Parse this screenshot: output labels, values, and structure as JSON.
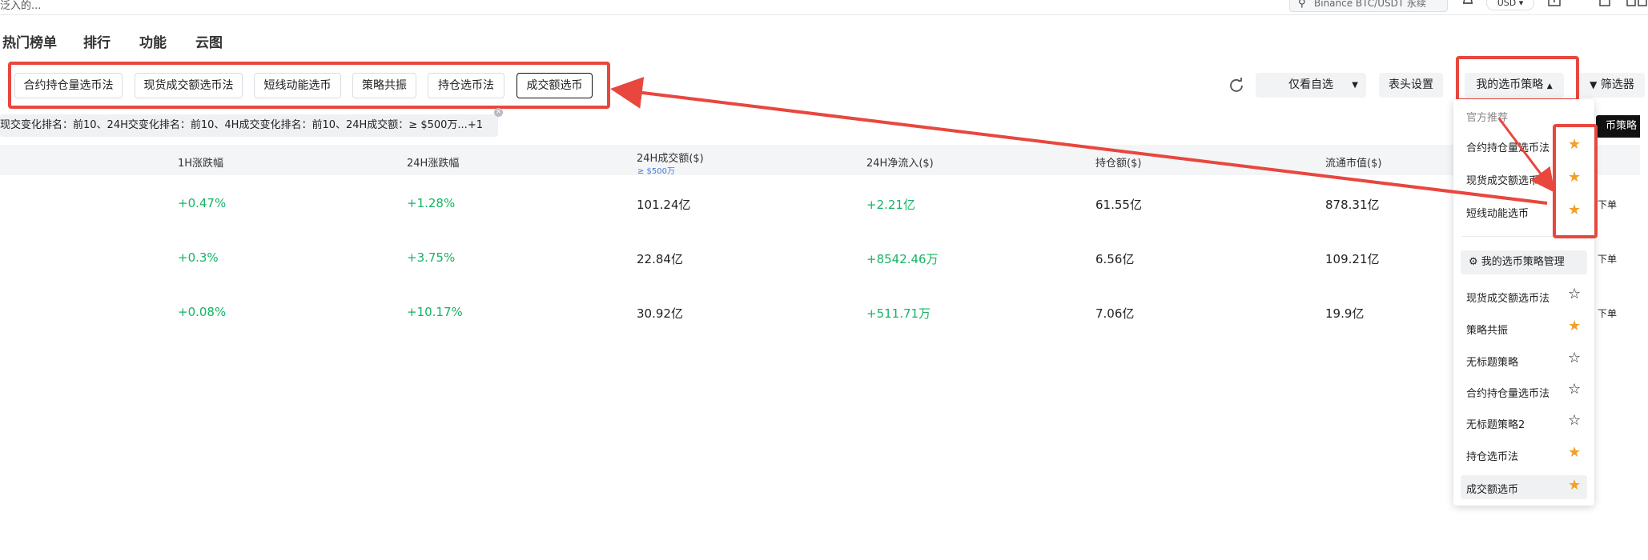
{
  "topbar": {
    "truncated_text": "泛入的...",
    "search_placeholder": "Binance BTC/USDT 永续",
    "currency": "USD",
    "currency_caret": "▾"
  },
  "nav": [
    "热门榜单",
    "排行",
    "功能",
    "云图"
  ],
  "strategy_chips": [
    "合约持仓量选币法",
    "现货成交额选币法",
    "短线动能选币",
    "策略共振",
    "持仓选币法",
    "成交额选币"
  ],
  "active_chip_index": 5,
  "controls": {
    "watchlist_only": "仅看自选",
    "header_settings": "表头设置",
    "my_strategy": "我的选币策略",
    "filter": "筛选器"
  },
  "filter_summary": "现交变化排名：前10、24H交变化排名：前10、4H成交变化排名：前10、24H成交额：≥ $500万...+1",
  "filter_close": "×",
  "black_button": "币策略",
  "table": {
    "headers": [
      "1H涨跌幅",
      "24H涨跌幅",
      "24H成交额($)",
      "24H净流入($)",
      "持仓额($)",
      "流通市值($)"
    ],
    "volume_sub": "≥ $500万",
    "rows": [
      {
        "h1": "+0.47%",
        "h24": "+1.28%",
        "vol": "101.24亿",
        "inflow": "+2.21亿",
        "oi": "61.55亿",
        "mcap": "878.31亿",
        "action": "下单"
      },
      {
        "h1": "+0.3%",
        "h24": "+3.75%",
        "vol": "22.84亿",
        "inflow": "+8542.46万",
        "oi": "6.56亿",
        "mcap": "109.21亿",
        "action": "下单"
      },
      {
        "h1": "+0.08%",
        "h24": "+10.17%",
        "vol": "30.92亿",
        "inflow": "+511.71万",
        "oi": "7.06亿",
        "mcap": "19.9亿",
        "action": "下单"
      }
    ]
  },
  "dropdown": {
    "official_label": "官方推荐",
    "official_items": [
      "合约持仓量选币法",
      "现货成交额选币法",
      "短线动能选币"
    ],
    "manage_label": "我的选币策略管理",
    "my_items": [
      {
        "label": "现货成交额选币法",
        "starred": false
      },
      {
        "label": "策略共振",
        "starred": true
      },
      {
        "label": "无标题策略",
        "starred": false
      },
      {
        "label": "合约持仓量选币法",
        "starred": false
      },
      {
        "label": "无标题策略2",
        "starred": false
      },
      {
        "label": "持仓选币法",
        "starred": true
      },
      {
        "label": "成交额选币",
        "starred": true
      }
    ]
  },
  "colors": {
    "accent_red": "#e8473e",
    "up_green": "#16b364",
    "star": "#f0a12b"
  }
}
